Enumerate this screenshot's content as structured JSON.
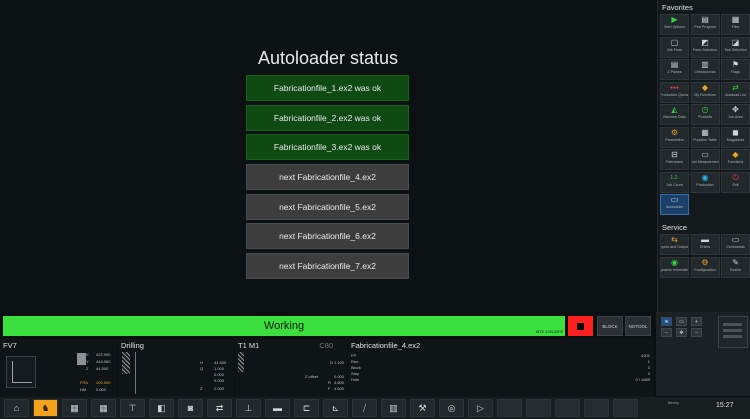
{
  "main": {
    "title": "Autoloader status",
    "rows": [
      {
        "text": "Fabricationfile_1.ex2 was ok",
        "state": "ok"
      },
      {
        "text": "Fabricationfile_2.ex2 was ok",
        "state": "ok"
      },
      {
        "text": "Fabricationfile_3.ex2 was ok",
        "state": "ok"
      },
      {
        "text": "next Fabricationfile_4.ex2",
        "state": "next"
      },
      {
        "text": "next Fabricationfile_5.ex2",
        "state": "next"
      },
      {
        "text": "next Fabricationfile_6.ex2",
        "state": "next"
      },
      {
        "text": "next Fabricationfile_7.ex2",
        "state": "next"
      }
    ]
  },
  "favorites": {
    "title": "Favorites",
    "tiles": [
      {
        "label": "Start Options",
        "icon": "play-icon"
      },
      {
        "label": "Part Program",
        "icon": "program-icon"
      },
      {
        "label": "Files",
        "icon": "files-icon"
      },
      {
        "label": "Job Form",
        "icon": "form-icon"
      },
      {
        "label": "Form Selection",
        "icon": "selection-icon"
      },
      {
        "label": "Tool Selection",
        "icon": "tool-selection-icon"
      },
      {
        "label": "Z Planes",
        "icon": "planes-icon"
      },
      {
        "label": "Critical Areas",
        "icon": "areas-icon"
      },
      {
        "label": "Flags",
        "icon": "flags-icon"
      },
      {
        "label": "Production Queue",
        "icon": "traffic-light-icon"
      },
      {
        "label": "My Functions",
        "icon": "functions-icon"
      },
      {
        "label": "Autoload List",
        "icon": "list-icon"
      },
      {
        "label": "Machine Data",
        "icon": "machine-icon"
      },
      {
        "label": "Products",
        "icon": "clock-icon"
      },
      {
        "label": "Job Area",
        "icon": "move-icon"
      },
      {
        "label": "Parameters",
        "icon": "parameters-icon"
      },
      {
        "label": "Function Table",
        "icon": "table-icon"
      },
      {
        "label": "Magazines",
        "icon": "magazine-icon"
      },
      {
        "label": "Tolerances",
        "icon": "tolerance-icon"
      },
      {
        "label": "Tool Measurement",
        "icon": "measure-icon"
      },
      {
        "label": "Functions",
        "icon": "functions-icon"
      },
      {
        "label": "Job Count",
        "icon": "count-icon"
      },
      {
        "label": "Production",
        "icon": "production-icon"
      },
      {
        "label": "Exit",
        "icon": "exit-icon"
      },
      {
        "label": "Autoloader",
        "icon": "monitor-icon",
        "active": true
      }
    ]
  },
  "service": {
    "title": "Service",
    "tiles": [
      {
        "label": "Inputs and Outputs",
        "icon": "io-icon"
      },
      {
        "label": "Drives",
        "icon": "drive-icon"
      },
      {
        "label": "Commands",
        "icon": "commands-icon"
      },
      {
        "label": "Dynamic Information",
        "icon": "dynamic-icon"
      },
      {
        "label": "Configuration",
        "icon": "gear-icon"
      },
      {
        "label": "Enable",
        "icon": "enable-icon"
      }
    ]
  },
  "status": {
    "working": "Working",
    "working_sub": "INTE-100100FE",
    "block": "BLOCK",
    "notool": "NOTOOL"
  },
  "info": {
    "fv": "FV7",
    "axes": [
      {
        "name": "X",
        "value": "422.990"
      },
      {
        "name": "Y",
        "value": "444.060"
      },
      {
        "name": "Z",
        "value": "44.500"
      }
    ],
    "feed_label": "FRA",
    "feed_value": "200.000",
    "hm_label": "HM",
    "hm_value": "0.000",
    "drilling": "Drilling",
    "drill_params": [
      {
        "name": "H",
        "value": "44.500"
      },
      {
        "name": "Q",
        "value": "1.000"
      },
      {
        "name": "",
        "value": "0.000"
      },
      {
        "name": "",
        "value": "0.000"
      },
      {
        "name": "Z",
        "value": "2.000"
      }
    ],
    "tool": "T1 M1",
    "tool_aux": "C80",
    "tool_params": [
      {
        "name": "D",
        "value": "1.100"
      },
      {
        "name": "",
        "value": ""
      },
      {
        "name": "Z offset",
        "value": "0.000"
      },
      {
        "name": "R",
        "value": "4.600"
      },
      {
        "name": "F",
        "value": "4.600"
      }
    ],
    "file": "Fabricationfile_4.ex2",
    "file_rows": [
      {
        "name": "FP",
        "value": "4201"
      },
      {
        "name": "Run",
        "value": "1"
      },
      {
        "name": "Block",
        "value": "0"
      },
      {
        "name": "Stop",
        "value": "0"
      },
      {
        "name": "Hole",
        "value": "0 / 1689"
      }
    ]
  },
  "taskbar": {
    "clock": "15:27",
    "user": "Benny"
  }
}
